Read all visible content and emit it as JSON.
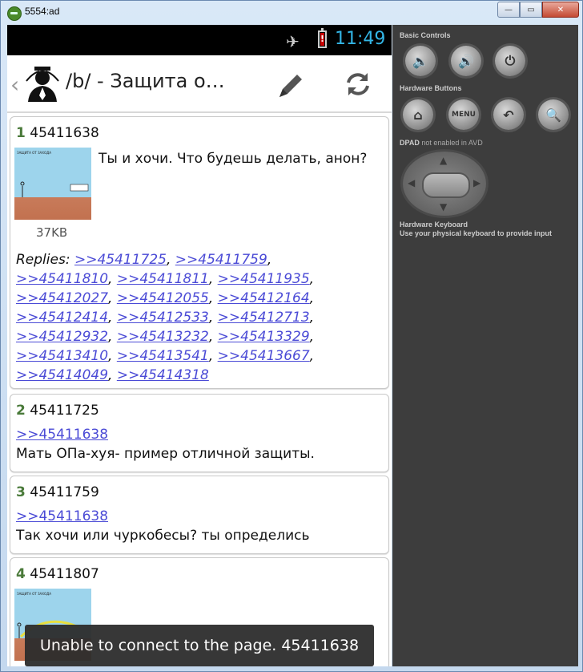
{
  "window": {
    "title": "5554:ad",
    "buttons": {
      "minimize": "—",
      "maximize": "▭",
      "close": "✕"
    }
  },
  "status_bar": {
    "time": "11:49",
    "icons": [
      "airplane-mode-icon",
      "battery-alert-icon"
    ],
    "time_color": "#33b5e5"
  },
  "action_bar": {
    "up_glyph": "‹",
    "title": "/b/ - Защита о…",
    "actions": [
      "edit-icon",
      "refresh-icon"
    ]
  },
  "posts": [
    {
      "index": "1",
      "id": "45411638",
      "text": "Ты и хочи. Что будешь делать, анон?",
      "thumb_size": "37KB",
      "thumb_caption": "ЗАЩИТА ОТ ЗАХОДА",
      "replies_label": "Replies:",
      "replies": [
        ">>45411725",
        ">>45411759",
        ">>45411810",
        ">>45411811",
        ">>45411935",
        ">>45412027",
        ">>45412055",
        ">>45412164",
        ">>45412414",
        ">>45412533",
        ">>45412713",
        ">>45412932",
        ">>45413232",
        ">>45413329",
        ">>45413410",
        ">>45413541",
        ">>45413667",
        ">>45414049",
        ">>45414318"
      ]
    },
    {
      "index": "2",
      "id": "45411725",
      "link": ">>45411638",
      "text": "Мать ОПа-хуя- пример отличной защиты."
    },
    {
      "index": "3",
      "id": "45411759",
      "link": ">>45411638",
      "text": "Так хочи или чуркобесы? ты определись"
    },
    {
      "index": "4",
      "id": "45411807",
      "thumb_caption": "ЗАЩИТА ОТ ЗАХОДА"
    }
  ],
  "toast": "Unable to connect to the page. 45411638",
  "controls": {
    "basic_label": "Basic Controls",
    "basic_buttons": [
      "volume-down-icon",
      "volume-up-icon",
      "power-icon"
    ],
    "hardware_label": "Hardware Buttons",
    "menu_label": "MENU",
    "hardware_buttons": [
      "home-icon",
      "menu-button",
      "back-icon",
      "search-icon"
    ],
    "dpad_label": "DPAD",
    "dpad_note": "not enabled in AVD",
    "keyboard_label": "Hardware Keyboard",
    "keyboard_note": "Use your physical keyboard to provide input"
  }
}
